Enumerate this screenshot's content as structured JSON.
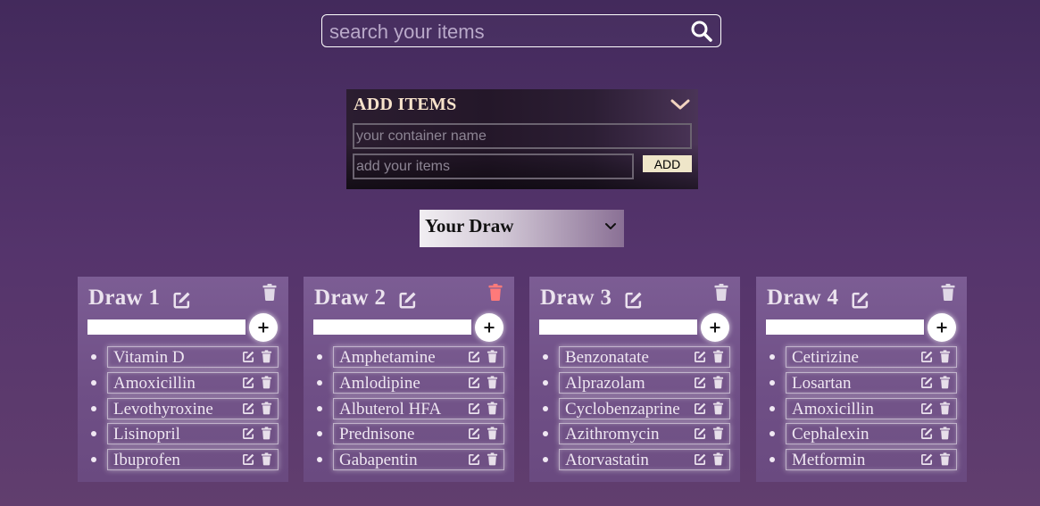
{
  "search": {
    "placeholder": "search your items",
    "value": "",
    "icon": "search-icon"
  },
  "add_panel": {
    "title": "ADD ITEMS",
    "container_placeholder": "your container name",
    "items_placeholder": "add your items",
    "add_label": "ADD",
    "chevron_icon": "chevron-down-icon"
  },
  "draw_select": {
    "selected": "Your Draw",
    "icon": "chevron-down-icon"
  },
  "colors": {
    "title_text": "#f8e3cb",
    "accent_delete": "#ff7a7a",
    "add_button_bg": "#efe6c9"
  },
  "draws": [
    {
      "title": "Draw 1",
      "items": [
        "Vitamin D",
        "Amoxicillin",
        "Levothyroxine",
        "Lisinopril",
        "Ibuprofen"
      ]
    },
    {
      "title": "Draw 2",
      "items": [
        "Amphetamine",
        "Amlodipine",
        "Albuterol HFA",
        "Prednisone",
        "Gabapentin"
      ]
    },
    {
      "title": "Draw 3",
      "items": [
        "Benzonatate",
        "Alprazolam",
        "Cyclobenzaprine",
        "Azithromycin",
        "Atorvastatin"
      ]
    },
    {
      "title": "Draw 4",
      "items": [
        "Cetirizine",
        "Losartan",
        "Amoxicillin",
        "Cephalexin",
        "Metformin"
      ]
    }
  ]
}
